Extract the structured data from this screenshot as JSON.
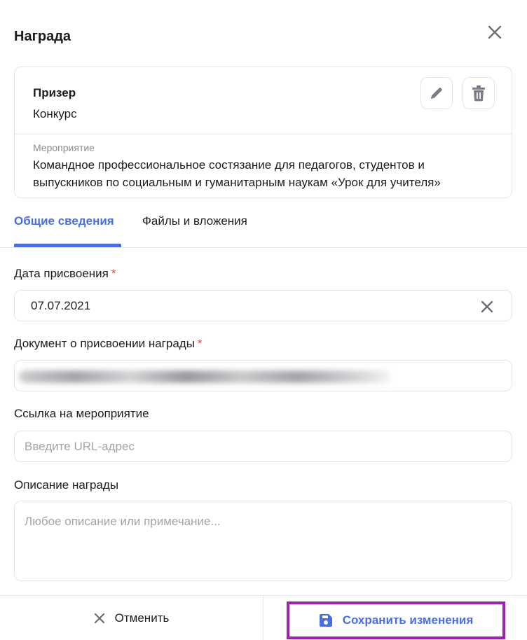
{
  "dialog": {
    "title": "Награда"
  },
  "award": {
    "name": "Призер",
    "type": "Конкурс",
    "event_label": "Мероприятие",
    "event_text": "Командное профессиональное состязание для педагогов, студентов и выпускников по социальным и гуманитарным наукам «Урок для учителя»"
  },
  "tabs": [
    {
      "label": "Общие сведения",
      "active": true
    },
    {
      "label": "Файлы и вложения",
      "active": false
    }
  ],
  "form": {
    "date": {
      "label": "Дата присвоения",
      "required_mark": "*",
      "value": "07.07.2021"
    },
    "document": {
      "label": "Документ о присвоении награды",
      "required_mark": "*"
    },
    "event_link": {
      "label": "Ссылка на мероприятие",
      "placeholder": "Введите URL-адрес"
    },
    "description": {
      "label": "Описание награды",
      "placeholder": "Любое описание или примечание..."
    }
  },
  "footer": {
    "cancel_label": "Отменить",
    "save_label": "Сохранить изменения"
  },
  "colors": {
    "accent": "#4a6ee0",
    "required": "#e5484d",
    "highlight_border": "#a020b0",
    "border": "#e3e4e9",
    "icon": "#6b6e78"
  },
  "icons": [
    "close-icon",
    "pencil-icon",
    "trash-icon",
    "clear-icon",
    "save-icon"
  ]
}
